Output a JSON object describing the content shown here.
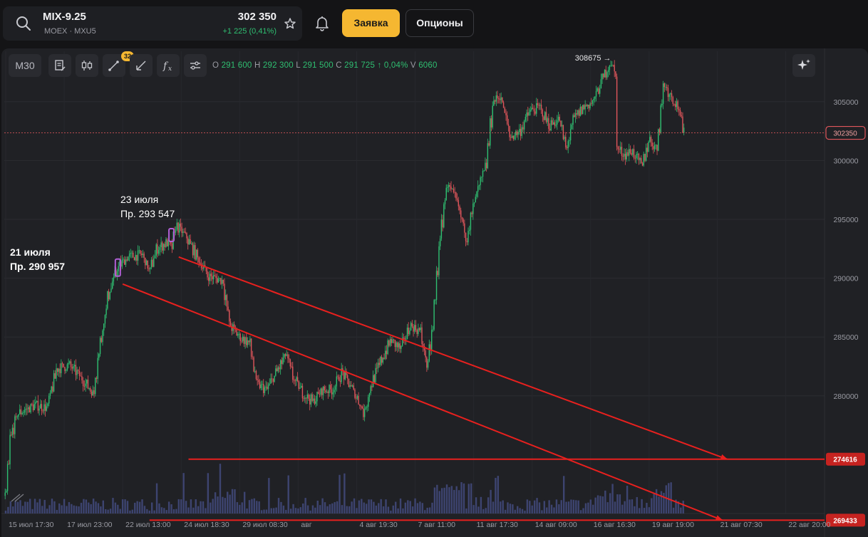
{
  "header": {
    "ticker": "MIX-9.25",
    "exchange": "MOEX · MXU5",
    "price": "302 350",
    "change": "+1 225 (0,41%)",
    "order_button": "Заявка",
    "options_button": "Опционы"
  },
  "toolbar": {
    "timeframe": "M30",
    "drawings_count": "32",
    "ohlc": {
      "o_label": "O",
      "o": "291 600",
      "h_label": "H",
      "h": "292 300",
      "l_label": "L",
      "l": "291 500",
      "c_label": "C",
      "c": "291 725",
      "change": "↑ 0,04%",
      "v_label": "V",
      "v": "6060"
    }
  },
  "colors": {
    "background": "#202125",
    "up": "#2fbf71",
    "down": "#e0565b",
    "annotation": "#e8201e",
    "accent": "#f5b731",
    "marker": "#b15fd6",
    "volume": "#3d4470"
  },
  "chart_data": {
    "type": "candlestick",
    "title": "",
    "ylim": [
      270000,
      308800
    ],
    "y_ticks": [
      280000,
      285000,
      290000,
      295000,
      300000,
      305000
    ],
    "y_tick_labels": [
      "280000",
      "285000",
      "290000",
      "295000",
      "300000",
      "305000"
    ],
    "x_ticks": [
      "15 июл 17:30",
      "17 июл 23:00",
      "22 июл 13:00",
      "24 июл 18:30",
      "29 июл 08:30",
      "авг",
      "4 авг 19:30",
      "7 авг 11:00",
      "11 авг 17:30",
      "14 авг 09:00",
      "16 авг 16:30",
      "19 авг 19:00",
      "21 авг 07:30",
      "22 авг 20:00"
    ],
    "x_tick_index": [
      0,
      24,
      48,
      72,
      96,
      120,
      144,
      168,
      192,
      216,
      240,
      264,
      292,
      320
    ],
    "last_price": 302350,
    "last_price_label": "302350",
    "high_marker": {
      "index": 247,
      "value": 308675,
      "label": "308675 →"
    },
    "price_path": [
      {
        "i": 0,
        "v": 271500
      },
      {
        "i": 2,
        "v": 276500
      },
      {
        "i": 5,
        "v": 278500
      },
      {
        "i": 12,
        "v": 279200
      },
      {
        "i": 17,
        "v": 279000
      },
      {
        "i": 21,
        "v": 282300
      },
      {
        "i": 26,
        "v": 282600
      },
      {
        "i": 29,
        "v": 282000
      },
      {
        "i": 33,
        "v": 281000
      },
      {
        "i": 36,
        "v": 280200
      },
      {
        "i": 38,
        "v": 283500
      },
      {
        "i": 42,
        "v": 288500
      },
      {
        "i": 46,
        "v": 290900
      },
      {
        "i": 50,
        "v": 291800
      },
      {
        "i": 56,
        "v": 292000
      },
      {
        "i": 59,
        "v": 290600
      },
      {
        "i": 62,
        "v": 292500
      },
      {
        "i": 66,
        "v": 293000
      },
      {
        "i": 68,
        "v": 292600
      },
      {
        "i": 70,
        "v": 294500
      },
      {
        "i": 74,
        "v": 293500
      },
      {
        "i": 78,
        "v": 292000
      },
      {
        "i": 83,
        "v": 290200
      },
      {
        "i": 89,
        "v": 289800
      },
      {
        "i": 92,
        "v": 286000
      },
      {
        "i": 96,
        "v": 285000
      },
      {
        "i": 100,
        "v": 284500
      },
      {
        "i": 103,
        "v": 281000
      },
      {
        "i": 107,
        "v": 280500
      },
      {
        "i": 111,
        "v": 282000
      },
      {
        "i": 115,
        "v": 283500
      },
      {
        "i": 118,
        "v": 281500
      },
      {
        "i": 122,
        "v": 280200
      },
      {
        "i": 126,
        "v": 279500
      },
      {
        "i": 130,
        "v": 280500
      },
      {
        "i": 134,
        "v": 280500
      },
      {
        "i": 138,
        "v": 282000
      },
      {
        "i": 141,
        "v": 281000
      },
      {
        "i": 145,
        "v": 279500
      },
      {
        "i": 147,
        "v": 278500
      },
      {
        "i": 150,
        "v": 281000
      },
      {
        "i": 154,
        "v": 283000
      },
      {
        "i": 158,
        "v": 284700
      },
      {
        "i": 162,
        "v": 284000
      },
      {
        "i": 166,
        "v": 286000
      },
      {
        "i": 170,
        "v": 285500
      },
      {
        "i": 173,
        "v": 282500
      },
      {
        "i": 175,
        "v": 285500
      },
      {
        "i": 178,
        "v": 293000
      },
      {
        "i": 181,
        "v": 298000
      },
      {
        "i": 185,
        "v": 296500
      },
      {
        "i": 189,
        "v": 293500
      },
      {
        "i": 193,
        "v": 297000
      },
      {
        "i": 197,
        "v": 299500
      },
      {
        "i": 200,
        "v": 305000
      },
      {
        "i": 203,
        "v": 305500
      },
      {
        "i": 207,
        "v": 302000
      },
      {
        "i": 211,
        "v": 302500
      },
      {
        "i": 215,
        "v": 304200
      },
      {
        "i": 219,
        "v": 304500
      },
      {
        "i": 223,
        "v": 303000
      },
      {
        "i": 227,
        "v": 303500
      },
      {
        "i": 230,
        "v": 301000
      },
      {
        "i": 233,
        "v": 303500
      },
      {
        "i": 237,
        "v": 304500
      },
      {
        "i": 241,
        "v": 305000
      },
      {
        "i": 245,
        "v": 307000
      },
      {
        "i": 248,
        "v": 308300
      },
      {
        "i": 250,
        "v": 307500
      },
      {
        "i": 251,
        "v": 301000
      },
      {
        "i": 254,
        "v": 300500
      },
      {
        "i": 257,
        "v": 300800
      },
      {
        "i": 261,
        "v": 299500
      },
      {
        "i": 264,
        "v": 301800
      },
      {
        "i": 267,
        "v": 301000
      },
      {
        "i": 270,
        "v": 306500
      },
      {
        "i": 273,
        "v": 305500
      },
      {
        "i": 276,
        "v": 304500
      },
      {
        "i": 278,
        "v": 302350
      }
    ],
    "annotations": [
      {
        "date_label": "21 июля",
        "price_label": "Пр. 290 957",
        "index": 46,
        "value": 290957
      },
      {
        "date_label": "23 июля",
        "price_label": "Пр. 293 547",
        "index": 68,
        "value": 293547
      }
    ],
    "levels": [
      {
        "value": 274616,
        "label": "274616",
        "from_index": 75
      },
      {
        "value": 269433,
        "label": "269433",
        "from_index": 59
      }
    ],
    "trend_lines": [
      {
        "from": {
          "i": 71,
          "v": 291800
        },
        "to": {
          "i": 296,
          "v": 274616
        }
      },
      {
        "from": {
          "i": 48,
          "v": 289500
        },
        "to": {
          "i": 294,
          "v": 269433
        }
      }
    ]
  }
}
